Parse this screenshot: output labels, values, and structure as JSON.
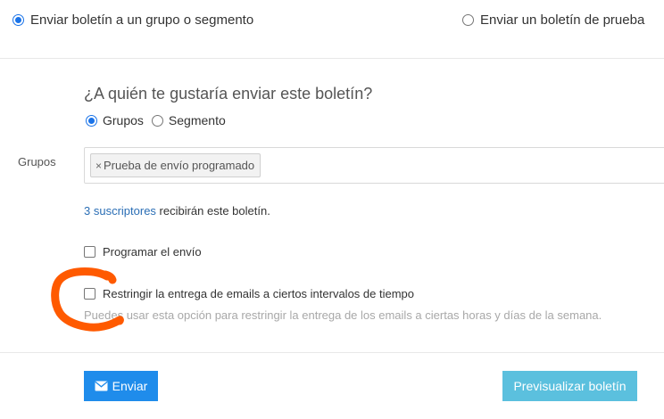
{
  "send_mode": {
    "group_option": "Enviar boletín a un grupo o segmento",
    "test_option": "Enviar un boletín de prueba",
    "selected": "group"
  },
  "recipient": {
    "question": "¿A quién te gustaría enviar este boletín?",
    "groups_option": "Grupos",
    "segment_option": "Segmento",
    "selected": "groups"
  },
  "groups": {
    "label": "Grupos",
    "tags": [
      "Prueba de envío programado"
    ],
    "remove_glyph": "×"
  },
  "subscribers": {
    "link_text": "3 suscriptores",
    "suffix": " recibirán este boletín."
  },
  "schedule": {
    "label": "Programar el envío",
    "checked": false
  },
  "restrict": {
    "label": "Restringir la entrega de emails a ciertos intervalos de tiempo",
    "help": "Puedes usar esta opción para restringir la entrega de los emails a ciertas horas y días de la semana.",
    "checked": false
  },
  "actions": {
    "send_label": "Enviar",
    "send_icon": "envelope-icon",
    "preview_label": "Previsualizar boletín"
  },
  "colors": {
    "primary": "#1f8ceb",
    "info": "#5bc0de",
    "link": "#2a6eb5",
    "annotation": "#ff5a00"
  },
  "annotation": {
    "shape": "hand-drawn circle around restrict checkbox"
  }
}
